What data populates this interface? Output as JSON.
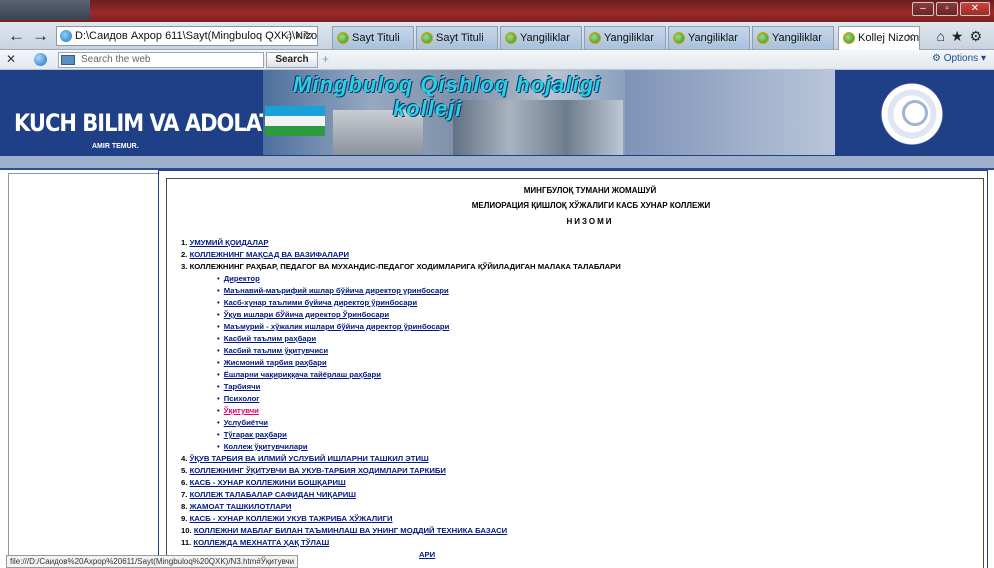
{
  "browser": {
    "address": "D:\\Саидов Ахрор 611\\Sayt(Mingbuloq QXK)\\Nizom.ht",
    "tabs": [
      {
        "label": "Sayt Tituli"
      },
      {
        "label": "Sayt Tituli"
      },
      {
        "label": "Yangiliklar"
      },
      {
        "label": "Yangiliklar"
      },
      {
        "label": "Yangiliklar"
      },
      {
        "label": "Yangiliklar"
      },
      {
        "label": "Kollej Nizomi"
      }
    ],
    "search_placeholder": "Search the web",
    "search_button": "Search",
    "options_label": "Options",
    "status_url": "file:///D:/Саидов%20Ахрор%20611/Sayt(Mingbuloq%20QXK)/N3.htm#Ўқитувчи"
  },
  "banner": {
    "slogan": "KUCH BILIM VA ADOLATDADUR",
    "author": "AMIR TEMUR.",
    "logo_line1": "Mingbuloq Qishloq hojaligi",
    "logo_line2": "kolleji"
  },
  "doc": {
    "heading1": "МИНГБУЛОҚ ТУМАНИ ЖОМАШУЙ",
    "heading2": "МЕЛИОРАЦИЯ ҚИШЛОҚ ХЎЖАЛИГИ КАСБ ХУНАР КОЛЛЕЖИ",
    "heading3": "НИЗОМИ",
    "items": [
      {
        "num": "1.",
        "text": "УМУМИЙ ҚОИДАЛАР"
      },
      {
        "num": "2.",
        "text": "КОЛЛЕЖНИНГ МАҚСАД ВА  ВАЗИФАЛАРИ"
      },
      {
        "num": "3.",
        "text": "КОЛЛЕЖНИНГ РАҲБАР, ПЕДАГОГ ВА МУХАНДИС-ПЕДАГОГ ХОДИМЛАРИГА ҚЎЙИЛАДИГАН  МАЛАКА ТАЛАБЛАРИ"
      },
      {
        "num": "4.",
        "text": "ЎҚУВ ТАРБИЯ ВА ИЛМИЙ УСЛУБИЙ ИШЛАРНИ ТАШКИЛ ЭТИШ"
      },
      {
        "num": "5.",
        "text": "КОЛЛЕЖНИНГ ЎҚИТУВЧИ ВА УКУВ-ТАРБИЯ ХОДИМЛАРИ ТАРКИБИ"
      },
      {
        "num": "6.",
        "text": "КАСБ - ХУНАР КОЛЛЕЖИНИ БОШҚАРИШ"
      },
      {
        "num": "7.",
        "text": "КОЛЛЕЖ ТАЛАБАЛАР  САФИДАН ЧИҚАРИШ"
      },
      {
        "num": "8.",
        "text": "ЖАМОАТ ТАШКИЛОТЛАРИ"
      },
      {
        "num": "9.",
        "text": "КАСБ -  ХУНАР КОЛЛЕЖИ УКУВ  ТАЖРИБА ХЎЖАЛИГИ"
      },
      {
        "num": "10.",
        "text": "КОЛЛЕЖНИ МАБЛАҒ БИЛАН ТАЪМИНЛАШ ВА УНИНГ МОДДИЙ ТЕХНИКА  БАЗАСИ"
      },
      {
        "num": "11.",
        "text": "КОЛЛЕЖДА МЕХНАТГА ҲАҚ ТЎЛАШ"
      },
      {
        "num": "",
        "text": "АРИ"
      }
    ],
    "subitems": [
      "Директор",
      "Маънавий-маърифий ишлар бўйича директор уринбосари",
      "Касб-хунар таълими буйича директор ўринбосари",
      "Ўқув ишлари бЎйича  директор Ўринбосари",
      "Маъмурий - хўжалик ишлари бўйича  директор ўринбосари",
      "Касбий таълим  раҳбари",
      "Касбий таълим ўқитувчиси",
      "Жисмоний  тарбия  раҳбари",
      "Ёшларни чақириққача тайёрлаш раҳбари",
      "Тарбиячи",
      "Психолог",
      "Ўқитувчи",
      "Услубиётчи",
      "Тўгарак раҳбари",
      "Коллеж ўқитувчилари"
    ]
  },
  "colors": {
    "banner": "#1f3f86",
    "link": "#001a80",
    "active_link": "#e0006f"
  }
}
